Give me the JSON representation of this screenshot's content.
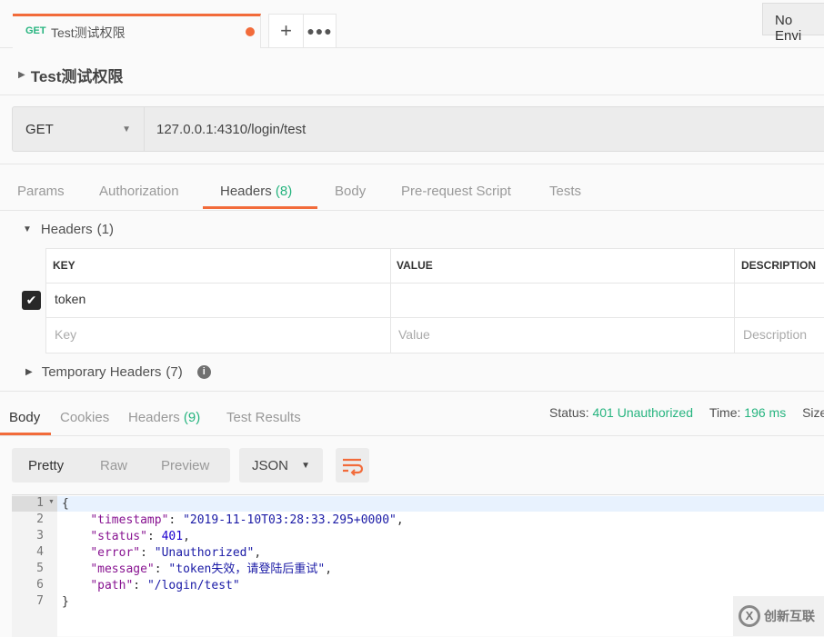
{
  "tab": {
    "method": "GET",
    "title": "Test测试权限",
    "unsaved": true
  },
  "environment": {
    "selected": "No Envi"
  },
  "request": {
    "name": "Test测试权限",
    "method": "GET",
    "url": "127.0.0.1:4310/login/test"
  },
  "request_tabs": [
    {
      "label": "Params"
    },
    {
      "label": "Authorization"
    },
    {
      "label": "Headers",
      "count": "(8)",
      "active": true
    },
    {
      "label": "Body"
    },
    {
      "label": "Pre-request Script"
    },
    {
      "label": "Tests"
    }
  ],
  "headers": {
    "title": "Headers",
    "count": "(1)",
    "columns": [
      "KEY",
      "VALUE",
      "DESCRIPTION"
    ],
    "rows": [
      {
        "checked": true,
        "key": "token",
        "value": "",
        "description": ""
      }
    ],
    "placeholder": {
      "key": "Key",
      "value": "Value",
      "description": "Description"
    }
  },
  "temporary_headers": {
    "label": "Temporary Headers",
    "count": "(7)"
  },
  "response_tabs": [
    {
      "label": "Body",
      "active": true
    },
    {
      "label": "Cookies"
    },
    {
      "label": "Headers",
      "count": "(9)"
    },
    {
      "label": "Test Results"
    }
  ],
  "response_meta": {
    "status_label": "Status:",
    "status": "401 Unauthorized",
    "time_label": "Time:",
    "time": "196 ms",
    "size_label": "Size"
  },
  "view_modes": [
    "Pretty",
    "Raw",
    "Preview"
  ],
  "format": "JSON",
  "body_lines": [
    "1",
    "2",
    "3",
    "4",
    "5",
    "6",
    "7"
  ],
  "body": {
    "timestamp": "2019-11-10T03:28:33.295+0000",
    "status": "401",
    "error": "Unauthorized",
    "message": "token失效，请登陆后重试",
    "path": "/login/test"
  },
  "watermark": "创新互联",
  "colors": {
    "accent": "#f26b3a",
    "success": "#26b47f",
    "json_key": "#881391",
    "json_string": "#1a1aa6"
  }
}
